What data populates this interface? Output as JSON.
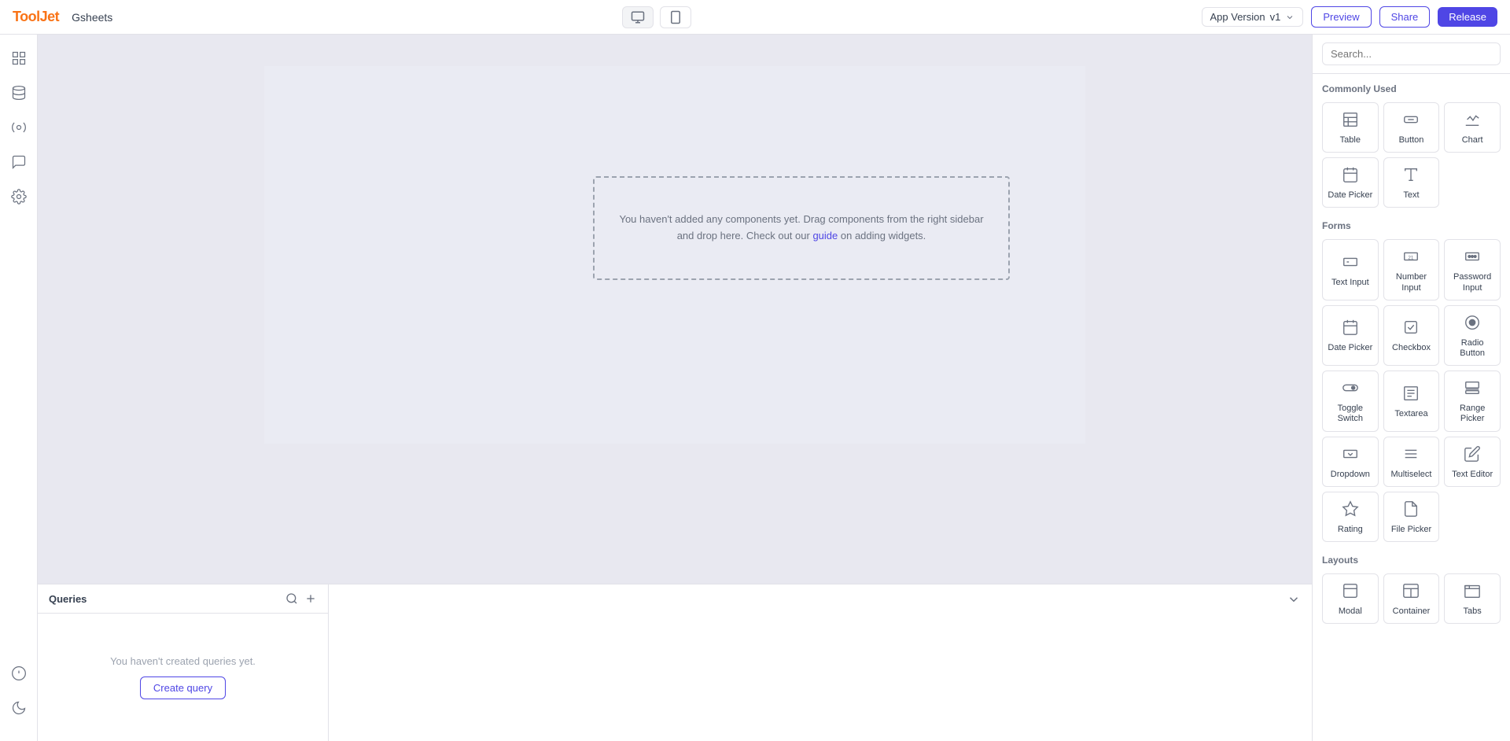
{
  "navbar": {
    "logo": "ToolJet",
    "app_name": "Gsheets",
    "device_desktop_label": "🖥",
    "device_mobile_label": "📱",
    "version_label": "App Version",
    "version_value": "v1",
    "preview_label": "Preview",
    "share_label": "Share",
    "release_label": "Release"
  },
  "canvas": {
    "empty_message_1": "You haven't added any components yet. Drag components from the right sidebar",
    "empty_message_2": "and drop here. Check out our",
    "empty_link_text": "guide",
    "empty_message_3": "on adding widgets."
  },
  "queries_panel": {
    "title": "Queries",
    "empty_text": "You haven't created queries yet.",
    "create_button_label": "Create query"
  },
  "components_sidebar": {
    "search_placeholder": "Search...",
    "sections": [
      {
        "title": "Commonly Used",
        "widgets": [
          {
            "label": "Table",
            "icon": "⊞"
          },
          {
            "label": "Button",
            "icon": "⬜"
          },
          {
            "label": "Chart",
            "icon": "📊"
          },
          {
            "label": "Date Picker",
            "icon": "📅"
          },
          {
            "label": "Text",
            "icon": "T"
          }
        ]
      },
      {
        "title": "Forms",
        "widgets": [
          {
            "label": "Text Input",
            "icon": "▭"
          },
          {
            "label": "Number Input",
            "icon": "21"
          },
          {
            "label": "Password Input",
            "icon": "***"
          },
          {
            "label": "Date Picker",
            "icon": "📅"
          },
          {
            "label": "Checkbox",
            "icon": "☑"
          },
          {
            "label": "Radio Button",
            "icon": "◎"
          },
          {
            "label": "Toggle Switch",
            "icon": "⬭"
          },
          {
            "label": "Textarea",
            "icon": "▬"
          },
          {
            "label": "Range Picker",
            "icon": "⊟"
          },
          {
            "label": "Dropdown",
            "icon": "▽"
          },
          {
            "label": "Multiselect",
            "icon": "≡"
          },
          {
            "label": "Text Editor",
            "icon": "✎"
          },
          {
            "label": "Rating",
            "icon": "☆"
          },
          {
            "label": "File Picker",
            "icon": "📄"
          }
        ]
      },
      {
        "title": "Layouts",
        "widgets": [
          {
            "label": "Modal",
            "icon": "⬜"
          },
          {
            "label": "Container",
            "icon": "⊞"
          },
          {
            "label": "Tabs",
            "icon": "⊟"
          }
        ]
      }
    ]
  }
}
